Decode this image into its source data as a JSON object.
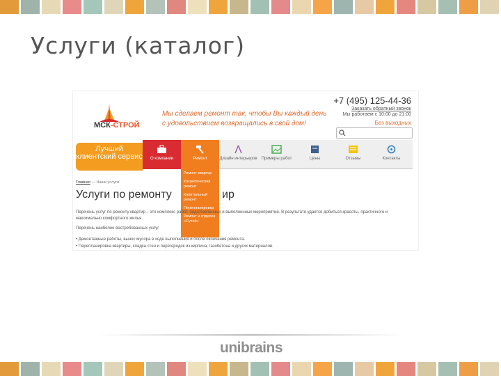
{
  "slide": {
    "title": "Услуги (каталог)",
    "brand": "unibrains",
    "stripe_colors": [
      "#e39a3b",
      "#9fb3aa",
      "#e7d9b6",
      "#e98a8b",
      "#a4c7b9",
      "#dfd6b9",
      "#f0a53c",
      "#b3c3ba",
      "#e0877f",
      "#efe0bd",
      "#f0a53c",
      "#c7b78d",
      "#a3c0b4",
      "#e48a8c",
      "#ead7af",
      "#f5a548",
      "#9db5ae",
      "#e8c9a5",
      "#f0a53c",
      "#e5867f",
      "#d6c9a2",
      "#a6bfb3",
      "#ee9f45",
      "#e0d3b4"
    ]
  },
  "site": {
    "logo_text_1": "МСК",
    "logo_text_2": "-СТРОЙ",
    "slogan_line1": "Мы сделаем ремонт так, чтобы Вы каждый день",
    "slogan_line2": "с удовольствием возвращались в свой дом!",
    "phone": "+7 (495) 125-44-36",
    "callback": "Заказать обратный звонок",
    "hours": "Мы работаем с 10:00 до 21:00",
    "weekend": "Без выходных",
    "search_placeholder": "",
    "promo": "Лучший клиентский сервис",
    "nav": [
      {
        "label": "О компании",
        "icon": "briefcase-icon"
      },
      {
        "label": "Ремонт",
        "icon": "hammer-icon"
      },
      {
        "label": "Дизайн интерьеров",
        "icon": "compass-icon"
      },
      {
        "label": "Примеры работ",
        "icon": "image-icon"
      },
      {
        "label": "Цены",
        "icon": "pricetag-icon"
      },
      {
        "label": "Отзывы",
        "icon": "reviews-icon"
      },
      {
        "label": "Контакты",
        "icon": "location-icon"
      }
    ],
    "dropdown": [
      "Ремонт квартир",
      "Косметический ремонт",
      "Капитальный ремонт",
      "Перепланировка",
      "Ремонт и отделка «Сухой»"
    ],
    "breadcrumb_home": "Главная",
    "breadcrumb_sep": "—",
    "breadcrumb_current": "Наши услуги",
    "page_heading_left": "Услуги по ремонту",
    "page_heading_right": "ир",
    "paragraph": "Перечень услуг по ремонту квартир – это комплекс работ, подготовленных и выполненных мероприятий. В результате удается добиться красоты, практичного и максимально комфортного жилья.",
    "subheading": "Перечень наиболее востребованных услуг",
    "bullets": [
      "Демонтажные работы, вынос мусора в ходе выполнения и после окончания ремонта.",
      "Перепланировка квартиры, кладка стен и перегородок из кирпича, газобетона и других материалов."
    ]
  }
}
